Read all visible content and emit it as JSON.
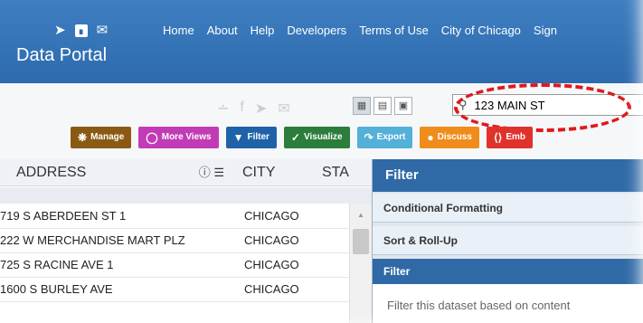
{
  "header": {
    "brand": "Data Portal",
    "social_icons": [
      "twitter-icon",
      "rss-icon",
      "mail-icon"
    ],
    "nav": [
      "Home",
      "About",
      "Help",
      "Developers",
      "Terms of Use",
      "City of Chicago",
      "Sign"
    ]
  },
  "toolbar": {
    "search": {
      "value": "123 MAIN ST",
      "placeholder": ""
    },
    "view_modes": [
      "table-view-icon",
      "list-view-icon",
      "page-view-icon"
    ],
    "actions": [
      {
        "label": "Manage",
        "color": "#8a5a14"
      },
      {
        "label": "More Views",
        "color": "#c23bb6"
      },
      {
        "label": "Filter",
        "color": "#1f62a8"
      },
      {
        "label": "Visualize",
        "color": "#2a7d3a"
      },
      {
        "label": "Export",
        "color": "#53b0d8"
      },
      {
        "label": "Discuss",
        "color": "#f08c1c"
      },
      {
        "label": "Emb",
        "color": "#e0322c"
      }
    ]
  },
  "table": {
    "columns": [
      "ADDRESS",
      "CITY",
      "STA"
    ],
    "rows": [
      {
        "address": "719 S ABERDEEN ST 1",
        "city": "CHICAGO"
      },
      {
        "address": "222 W MERCHANDISE MART PLZ",
        "city": "CHICAGO"
      },
      {
        "address": "725 S RACINE AVE 1",
        "city": "CHICAGO"
      },
      {
        "address": "1600 S BURLEY AVE",
        "city": "CHICAGO"
      }
    ]
  },
  "panel": {
    "title": "Filter",
    "sections": [
      "Conditional Formatting",
      "Sort & Roll-Up"
    ],
    "filter_header": "Filter",
    "filter_text": "Filter this dataset based on content"
  }
}
